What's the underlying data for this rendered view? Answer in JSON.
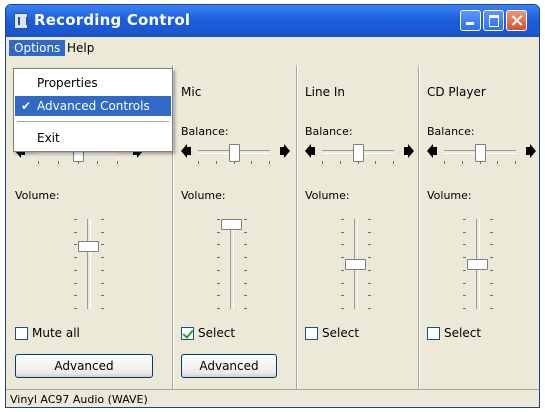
{
  "window": {
    "title": "Recording Control"
  },
  "menubar": {
    "items": [
      {
        "label": "Options"
      },
      {
        "label": "Help"
      }
    ]
  },
  "options_menu": {
    "items": [
      {
        "label": "Properties",
        "checked": false,
        "highlighted": false
      },
      {
        "label": "Advanced Controls",
        "checked": true,
        "highlighted": true
      },
      {
        "label": "Exit",
        "checked": false,
        "highlighted": false
      }
    ],
    "check_glyph": "✔"
  },
  "columns": [
    {
      "label": "",
      "balance_label": "Balance:",
      "volume_label": "Volume:",
      "balance": 0.5,
      "volume": 0.7,
      "checkbox_label": "Mute all",
      "checked": false,
      "button_label": "Advanced"
    },
    {
      "label": "Mic",
      "balance_label": "Balance:",
      "volume_label": "Volume:",
      "balance": 0.5,
      "volume": 0.95,
      "checkbox_label": "Select",
      "checked": true,
      "button_label": "Advanced"
    },
    {
      "label": "Line In",
      "balance_label": "Balance:",
      "volume_label": "Volume:",
      "balance": 0.5,
      "volume": 0.5,
      "checkbox_label": "Select",
      "checked": false
    },
    {
      "label": "CD Player",
      "balance_label": "Balance:",
      "volume_label": "Volume:",
      "balance": 0.5,
      "volume": 0.5,
      "checkbox_label": "Select",
      "checked": false
    }
  ],
  "statusbar": {
    "text": "Vinyl AC97 Audio (WAVE)"
  },
  "colors": {
    "titlebar": "#1d5fdd",
    "menu_highlight": "#316ac5",
    "face": "#ece9d8"
  },
  "icons": {
    "title": "mixer-icon",
    "speaker_left": "speaker-left-icon",
    "speaker_right": "speaker-right-icon"
  }
}
